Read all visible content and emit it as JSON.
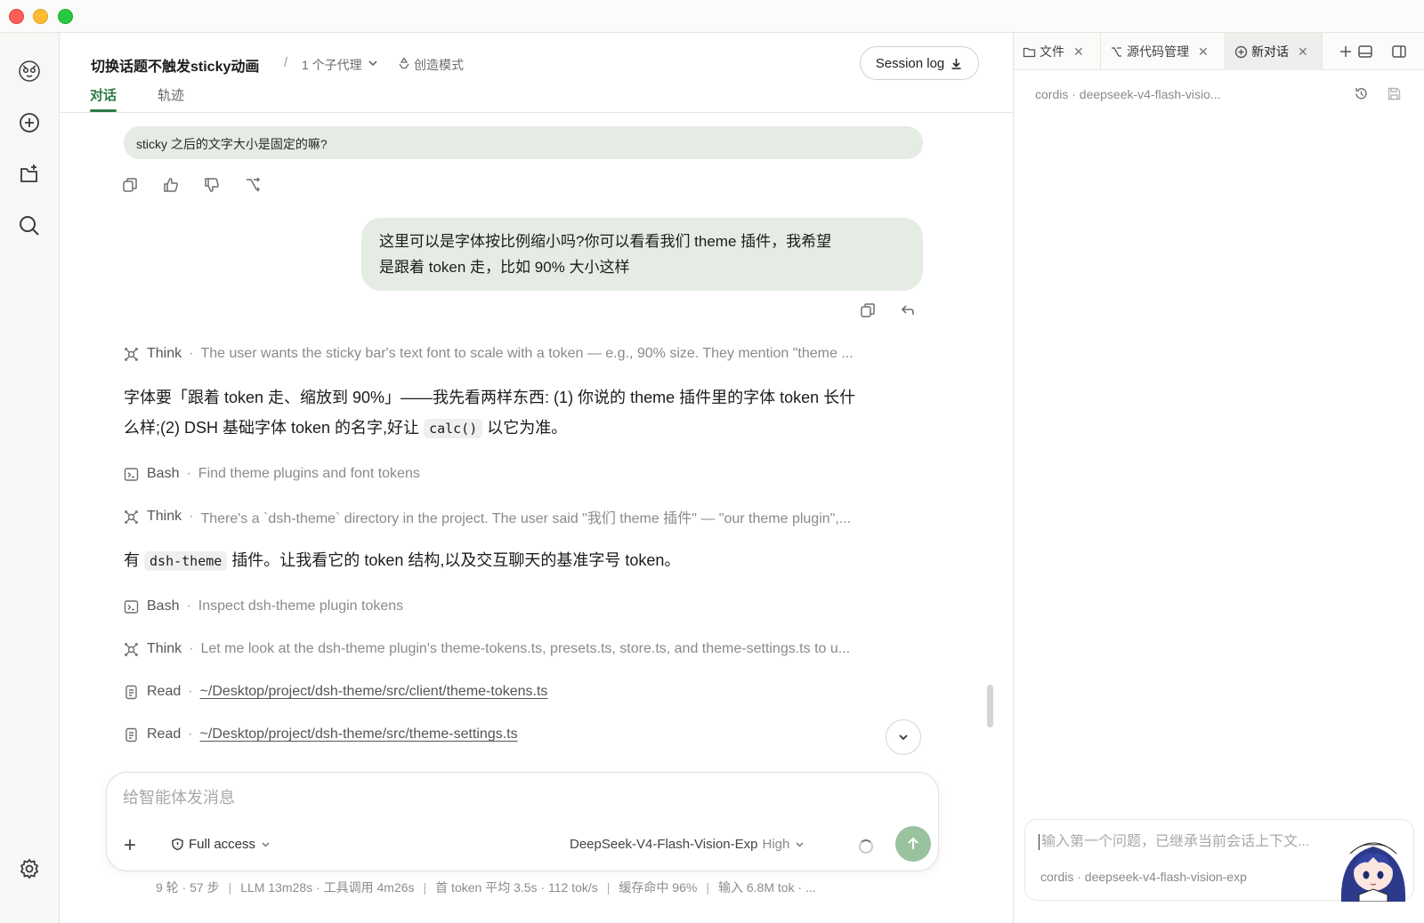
{
  "header": {
    "title": "切换话题不触发sticky动画",
    "separator": "/",
    "subagents": "1 个子代理",
    "mode": "创造模式",
    "session_log": "Session log",
    "tabs": [
      "对话",
      "轨迹"
    ]
  },
  "chat": {
    "prev_user_message": "sticky 之后的文字大小是固定的嘛?",
    "user_message_line1": "这里可以是字体按比例缩小吗?你可以看看我们 theme 插件，我希望",
    "user_message_line2": "是跟着 token 走，比如 90% 大小这样",
    "think1_label": "Think",
    "think1_text": "The user wants the sticky bar's text font to scale with a token — e.g., 90% size. They mention \"theme ...",
    "prose1_a": "字体要「跟着 token 走、缩放到 90%」——我先看两样东西: (1) 你说的 theme 插件里的字体 token 长什",
    "prose1_b": "么样;(2) DSH 基础字体 token 的名字,好让",
    "prose1_code": "calc()",
    "prose1_c": "以它为准。",
    "bash1_label": "Bash",
    "bash1_text": "Find theme plugins and font tokens",
    "think2_label": "Think",
    "think2_text": "There's a `dsh-theme` directory in the project. The user said \"我们 theme 插件\" — \"our theme plugin\",...",
    "prose2_a": "有",
    "prose2_code": "dsh-theme",
    "prose2_b": "插件。让我看它的 token 结构,以及交互聊天的基准字号 token。",
    "bash2_label": "Bash",
    "bash2_text": "Inspect dsh-theme plugin tokens",
    "think3_label": "Think",
    "think3_text": "Let me look at the dsh-theme plugin's theme-tokens.ts, presets.ts, store.ts, and theme-settings.ts to u...",
    "read1_label": "Read",
    "read1_path": "~/Desktop/project/dsh-theme/src/client/theme-tokens.ts",
    "read2_label": "Read",
    "read2_path": "~/Desktop/project/dsh-theme/src/theme-settings.ts",
    "dot": "·"
  },
  "composer": {
    "placeholder": "给智能体发消息",
    "access": "Full access",
    "model": "DeepSeek-V4-Flash-Vision-Exp",
    "effort": "High"
  },
  "stats": {
    "rounds": "9 轮 · 57 步",
    "llm": "LLM 13m28s · 工具调用 4m26s",
    "first_token": "首 token 平均 3.5s · 112 tok/s",
    "cache": "缓存命中 96%",
    "input": "输入 6.8M tok · ...",
    "sep": "|"
  },
  "right_panel": {
    "tabs": [
      "文件",
      "源代码管理",
      "新对话"
    ],
    "meta": "cordis · deepseek-v4-flash-visio...",
    "input_placeholder": "输入第一个问题，已继承当前会话上下文...",
    "model": "cordis · deepseek-v4-flash-vision-exp"
  },
  "colors": {
    "accent": "#2f7a45",
    "bubble": "#e5ece4",
    "send": "#9ac29f"
  }
}
